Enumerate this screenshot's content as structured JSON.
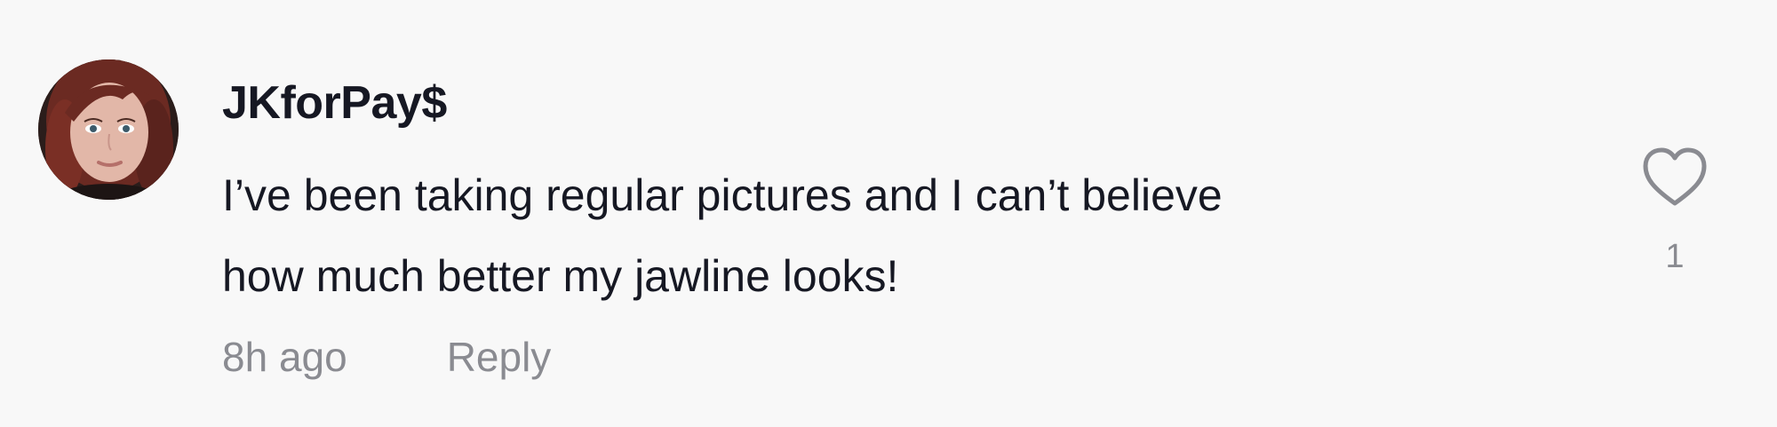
{
  "comment": {
    "username": "JKforPay$",
    "text_lines": [
      "I’ve been taking regular pictures and I can’t believe",
      "how much better my jawline looks!"
    ],
    "time": "8h ago",
    "reply_label": "Reply",
    "like_count": "1",
    "like_icon": "heart-outline-icon",
    "avatar": "user-avatar-photo"
  },
  "colors": {
    "background": "#f8f8f8",
    "primary_text": "#161823",
    "secondary_text": "#8a8b91"
  }
}
